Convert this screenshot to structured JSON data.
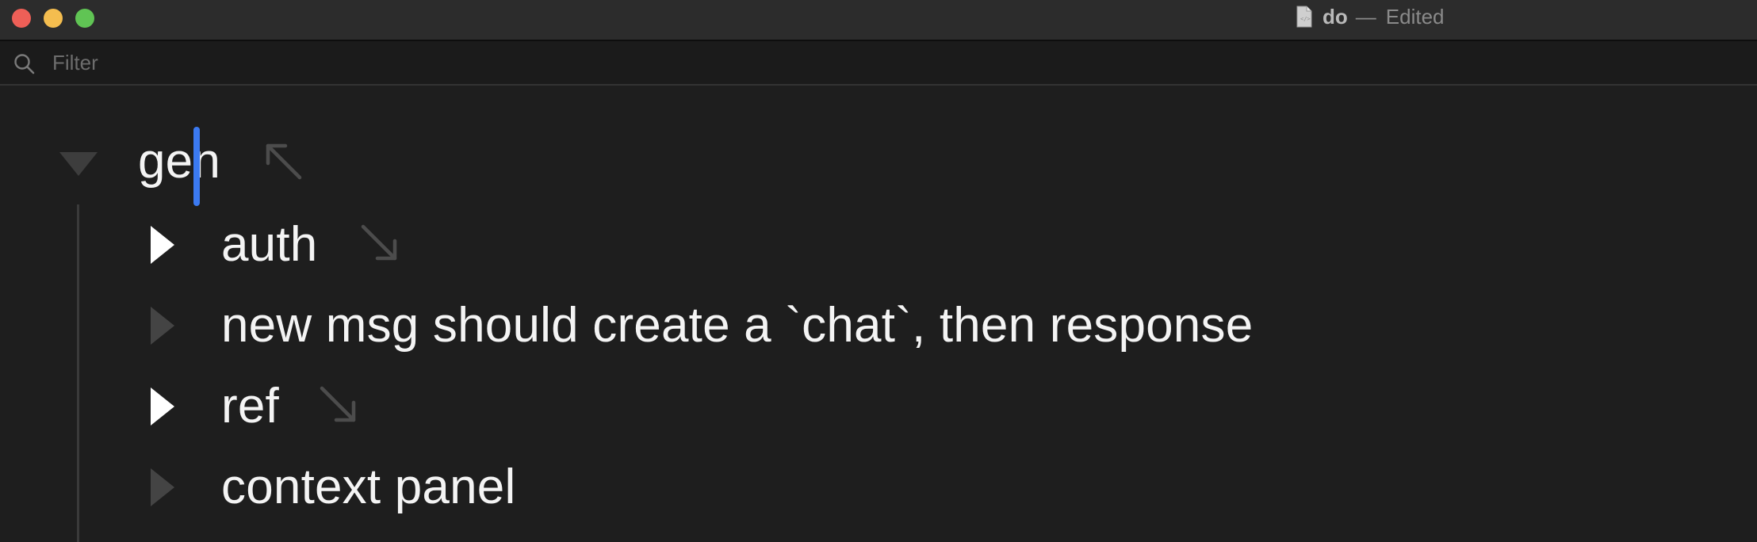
{
  "window": {
    "title": "do",
    "separator": "—",
    "status": "Edited"
  },
  "filter": {
    "placeholder": "Filter",
    "value": ""
  },
  "outline": {
    "root": {
      "label": "gen",
      "expanded": true
    },
    "items": [
      {
        "label": "auth",
        "has_children": true,
        "link_icon": "arrow-down-right-icon"
      },
      {
        "label": "new msg should create a `chat`, then response",
        "has_children": false
      },
      {
        "label": "ref",
        "has_children": true,
        "link_icon": "arrow-down-right-icon"
      },
      {
        "label": "context panel",
        "has_children": false
      }
    ]
  },
  "colors": {
    "background": "#1e1e1e",
    "titlebar": "#2c2c2c",
    "caret": "#3b7af2",
    "text": "#f4f4f4"
  }
}
